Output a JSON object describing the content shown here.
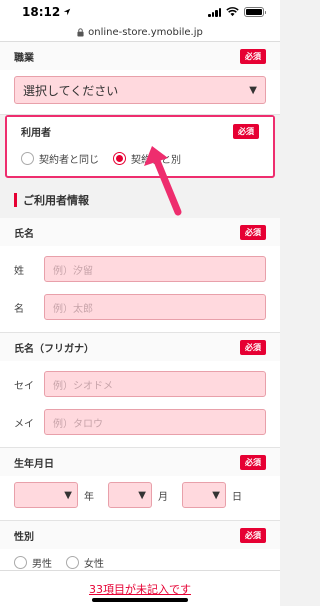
{
  "status": {
    "time": "18:12"
  },
  "browser": {
    "url": "online-store.ymobile.jp"
  },
  "required_label": "必須",
  "occupation": {
    "label": "職業",
    "value": "選択してください"
  },
  "user": {
    "label": "利用者",
    "options": [
      "契約者と同じ",
      "契約者と別"
    ],
    "selected_index": 1
  },
  "user_info": {
    "title": "ご利用者情報"
  },
  "name": {
    "label": "氏名",
    "last_label": "姓",
    "last_placeholder": "例）汐留",
    "first_label": "名",
    "first_placeholder": "例）太郎"
  },
  "kana": {
    "label": "氏名（フリガナ）",
    "last_label": "セイ",
    "last_placeholder": "例）シオドメ",
    "first_label": "メイ",
    "first_placeholder": "例）タロウ"
  },
  "birthday": {
    "label": "生年月日",
    "year": "年",
    "month": "月",
    "day": "日"
  },
  "gender": {
    "label": "性別",
    "options": [
      "男性",
      "女性"
    ]
  },
  "footer": {
    "missing_text": "33項目が未記入です"
  },
  "colors": {
    "accent": "#e60033",
    "highlight": "#ee2d6e",
    "input_bg": "#ffd9de"
  }
}
